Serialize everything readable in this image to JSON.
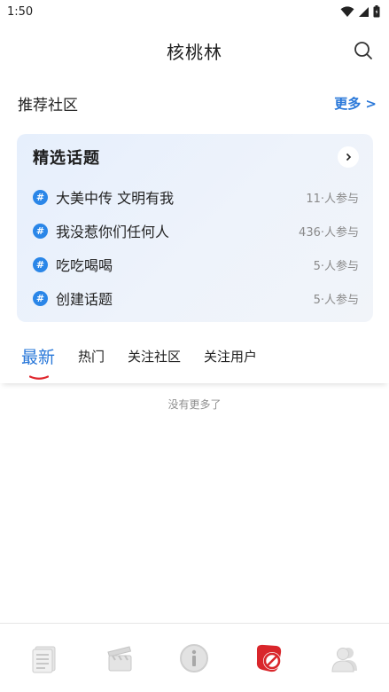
{
  "status_bar": {
    "time": "1:50"
  },
  "header": {
    "title": "核桃林"
  },
  "section": {
    "title": "推荐社区",
    "more_label": "更多 >"
  },
  "topic_card": {
    "title": "精选话题",
    "items": [
      {
        "name": "大美中传 文明有我",
        "count": "11·人参与"
      },
      {
        "name": "我没惹你们任何人",
        "count": "436·人参与"
      },
      {
        "name": "吃吃喝喝",
        "count": "5·人参与"
      },
      {
        "name": "创建话题",
        "count": "5·人参与"
      }
    ]
  },
  "tabs": [
    {
      "label": "最新",
      "active": true
    },
    {
      "label": "热门"
    },
    {
      "label": "关注社区"
    },
    {
      "label": "关注用户"
    }
  ],
  "feed": {
    "empty_text": "没有更多了"
  },
  "bottom_nav": [
    {
      "icon": "newspaper-icon"
    },
    {
      "icon": "clapperboard-icon"
    },
    {
      "icon": "info-icon"
    },
    {
      "icon": "community-icon",
      "active": true
    },
    {
      "icon": "profile-icon"
    }
  ],
  "colors": {
    "accent": "#2a78d9",
    "active_nav": "#d9262b",
    "tab_indicator": "#e0272e"
  }
}
